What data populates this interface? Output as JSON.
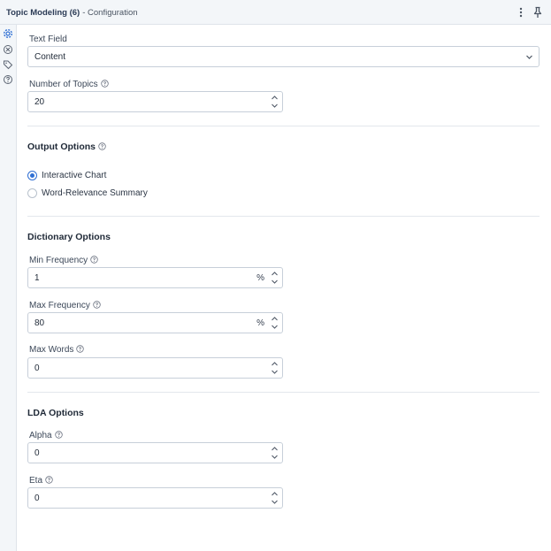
{
  "header": {
    "title": "Topic Modeling (6)",
    "subtitle": "- Configuration"
  },
  "rail": {
    "icons": [
      "gear-icon",
      "circle-x-icon",
      "tag-icon",
      "question-icon"
    ]
  },
  "text_field": {
    "label": "Text Field",
    "value": "Content"
  },
  "num_topics": {
    "label": "Number of Topics",
    "value": "20"
  },
  "output_options": {
    "heading": "Output Options",
    "options": [
      "Interactive Chart",
      "Word-Relevance Summary"
    ],
    "selected": "Interactive Chart"
  },
  "dictionary_options": {
    "heading": "Dictionary Options",
    "min_frequency": {
      "label": "Min Frequency",
      "value": "1",
      "unit": "%"
    },
    "max_frequency": {
      "label": "Max Frequency",
      "value": "80",
      "unit": "%"
    },
    "max_words": {
      "label": "Max Words",
      "value": "0"
    }
  },
  "lda_options": {
    "heading": "LDA Options",
    "alpha": {
      "label": "Alpha",
      "value": "0"
    },
    "eta": {
      "label": "Eta",
      "value": "0"
    }
  },
  "colors": {
    "accent": "#2f6fd3",
    "header_bg": "#f3f6f9",
    "border": "#c7cfd9"
  }
}
